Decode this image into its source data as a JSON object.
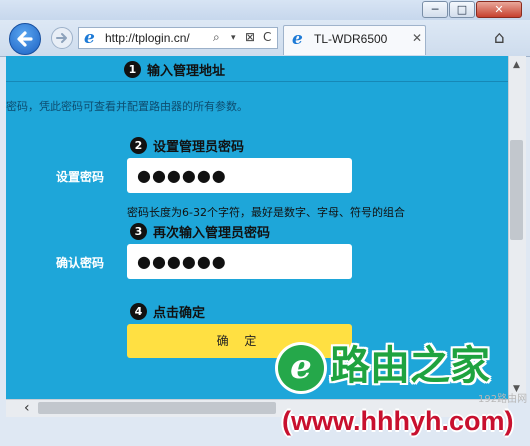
{
  "browser": {
    "address": "http://tplogin.cn/",
    "tab_title": "TL-WDR6500",
    "window_min": "─",
    "window_max": "□",
    "window_close": "✕",
    "address_tools": [
      "⌕",
      "▾",
      "⊠",
      "C"
    ],
    "tab_close": "✕",
    "home_glyph": "⌂"
  },
  "page": {
    "step1": {
      "num": "1",
      "label": "输入管理地址"
    },
    "intro": "密码，凭此密码可查看并配置路由器的所有参数。",
    "step2": {
      "num": "2",
      "label": "设置管理员密码"
    },
    "password_label": "设置密码",
    "password_value": "●●●●●●",
    "hint": "密码长度为6-32个字符，最好是数字、字母、符号的组合",
    "step3": {
      "num": "3",
      "label": "再次输入管理员密码"
    },
    "confirm_label": "确认密码",
    "confirm_value": "●●●●●●",
    "step4": {
      "num": "4",
      "label": "点击确定"
    },
    "confirm_button": "确 定"
  },
  "watermark": {
    "title": "路由之家",
    "url": "(www.hhhyh.com)",
    "small": "192路由网"
  },
  "colors": {
    "page_bg": "#1ea6d9",
    "button_bg": "#ffe042",
    "watermark_green": "#1fa33f",
    "watermark_red": "#c8102e"
  },
  "icons": [
    "back-arrow-icon",
    "forward-arrow-icon",
    "ie-logo-icon",
    "search-icon",
    "home-icon",
    "scroll-left-icon"
  ]
}
